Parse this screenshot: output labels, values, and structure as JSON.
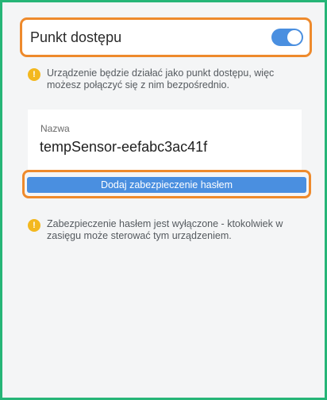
{
  "header": {
    "title": "Punkt dostępu",
    "toggle_on": true
  },
  "info_ap": {
    "icon": "warning-icon",
    "text": "Urządzenie będzie działać jako punkt dostępu, więc możesz połączyć się z nim bezpośrednio."
  },
  "name_card": {
    "label": "Nazwa",
    "value": "tempSensor-eefabc3ac41f"
  },
  "password_button": {
    "label": "Dodaj zabezpieczenie hasłem"
  },
  "info_security": {
    "icon": "warning-icon",
    "text": "Zabezpieczenie hasłem jest wyłączone - ktokolwiek w zasięgu może sterować tym urządzeniem."
  },
  "colors": {
    "accent": "#4a8fe0",
    "warning": "#f3b81f",
    "highlight": "#ee8a2c",
    "frame": "#26b577"
  }
}
